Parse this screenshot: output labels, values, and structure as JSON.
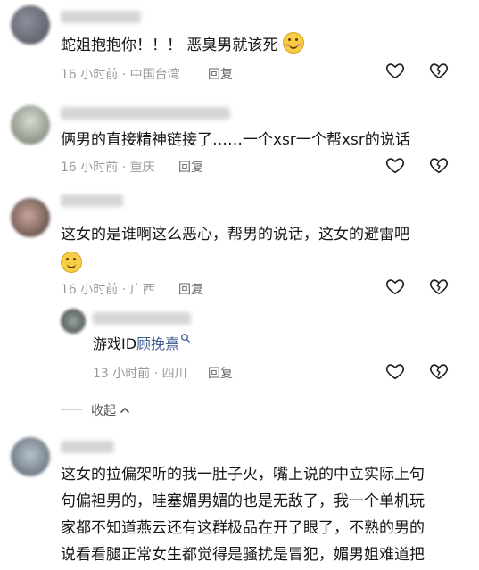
{
  "comments": [
    {
      "text": "蛇姐抱抱你！！！ 恶臭男就该死",
      "time": "16 小时前",
      "location": "中国台湾",
      "reply_label": "回复"
    },
    {
      "text": "俩男的直接精神链接了……一个xsr一个帮xsr的说话",
      "time": "16 小时前",
      "location": "重庆",
      "reply_label": "回复"
    },
    {
      "text": "这女的是谁啊这么恶心，帮男的说话，这女的避雷吧",
      "time": "16 小时前",
      "location": "广西",
      "reply_label": "回复",
      "sub_reply": {
        "text_prefix": "游戏ID",
        "text_link": "顾挽熹",
        "time": "13 小时前",
        "location": "四川",
        "reply_label": "回复"
      }
    },
    {
      "lines": [
        "这女的拉偏架听的我一肚子火，嘴上说的中立实际上句",
        "句偏袒男的，哇塞媚男媚的也是无敌了，我一个单机玩",
        "家都不知道燕云还有这群极品在开了眼了，不熟的男的",
        "说看看腿正常女生都觉得是骚扰是冒犯，媚男姐难道把"
      ]
    }
  ],
  "collapse_label": "收起",
  "separator": "·",
  "icons": {
    "like": "heart-outline-icon",
    "dislike": "broken-heart-icon",
    "collapse": "chevron-up-icon",
    "search": "search-icon"
  }
}
